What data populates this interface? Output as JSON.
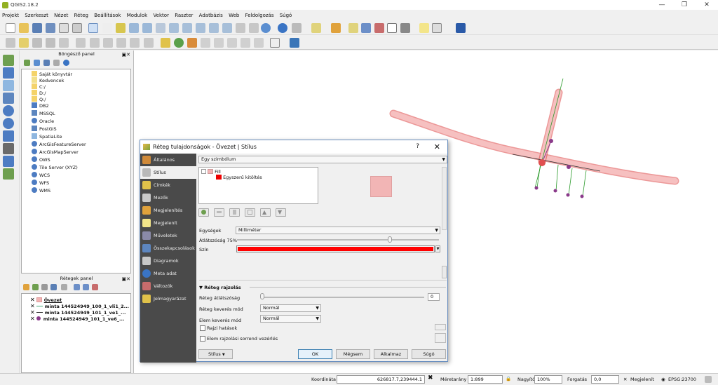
{
  "window": {
    "title": "QGIS2.18.2",
    "min": "—",
    "max": "❐",
    "close": "✕"
  },
  "menu": [
    "Projekt",
    "Szerkeszt",
    "Nézet",
    "Réteg",
    "Beállítások",
    "Modulok",
    "Vektor",
    "Raszter",
    "Adatbázis",
    "Web",
    "Feldolgozás",
    "Súgó"
  ],
  "browser": {
    "title": "Böngésző panel",
    "items": [
      "Saját könyvtár",
      "Kedvencek",
      "C:/",
      "D:/",
      "Q:/",
      "DB2",
      "MSSQL",
      "Oracle",
      "PostGIS",
      "SpatiaLite",
      "ArcGisFeatureServer",
      "ArcGisMapServer",
      "OWS",
      "Tile Server (XYZ)",
      "WCS",
      "WFS",
      "WMS"
    ]
  },
  "layers": {
    "title": "Rétegek panel",
    "items": [
      "Övezet",
      "minta 144524949_100_1_vli1_2...",
      "minta 144524949_101_1_ve1_...",
      "minta 144524949_101_1_ve6_..."
    ]
  },
  "dialog": {
    "title": "Réteg tulajdonságok - Övezet | Stílus",
    "help": "?",
    "close": "✕",
    "sidebar": [
      "Általános",
      "Stílus",
      "Címkék",
      "Mezők",
      "Megjelenítés",
      "Megjelenít",
      "Műveletek",
      "Összekapcsolások",
      "Diagramok",
      "Meta adat",
      "Változók",
      "Jelmagyarázat"
    ],
    "renderer": "Egy szimbólum",
    "tree_fill": "Fill",
    "tree_simple": "Egyszerű kitöltés",
    "units_label": "Egységek",
    "units_value": "Milliméter",
    "opacity_label": "Átlátszóság 75%",
    "color_label": "Szín",
    "rendering_section": "Réteg rajzolás",
    "layer_transparency_label": "Réteg átlátszóság",
    "layer_transparency_value": "0",
    "layer_blend_label": "Réteg keverés mód",
    "layer_blend_value": "Normál",
    "feature_blend_label": "Elem keverés mód",
    "feature_blend_value": "Normál",
    "draw_effects_label": "Rajzi hatások",
    "ordering_label": "Elem rajzolási sorrend vezérlés",
    "style_button": "Stílus",
    "ok": "OK",
    "cancel": "Mégsem",
    "apply": "Alkalmaz",
    "help_button": "Súgó",
    "fill_color": "#ff0000",
    "preview_color": "#f2b5b5"
  },
  "status": {
    "coord_label": "Koordináta",
    "coord_value": "626817.7,239444.1",
    "scale_label": "Méretarány",
    "scale_value": "1:899",
    "mag_label": "Nagyító",
    "mag_value": "100%",
    "rotation_label": "Forgatás",
    "rotation_value": "0,0",
    "render_label": "Megjelenít",
    "crs_value": "EPSG:23700"
  }
}
